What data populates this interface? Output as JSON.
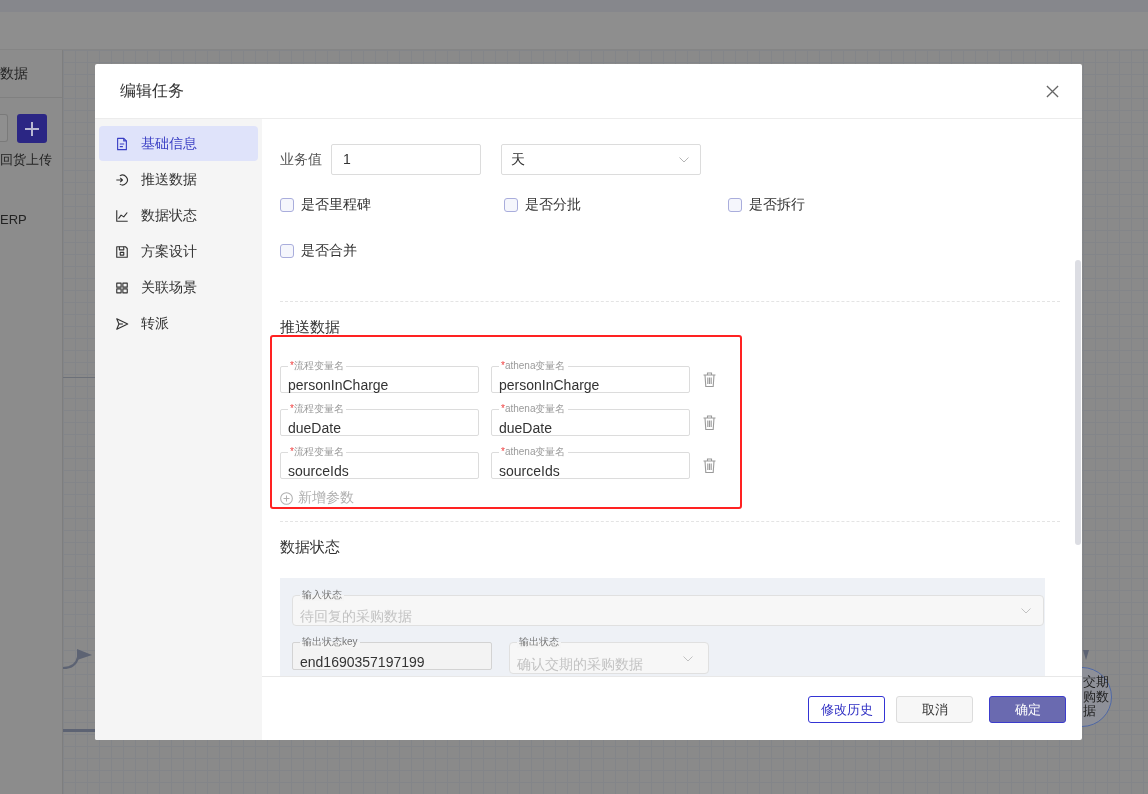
{
  "background": {
    "side_panel": {
      "title": "数据",
      "items": [
        "回货上传",
        "ERP"
      ]
    },
    "canvas": {
      "node": {
        "lines": [
          "交期",
          "购数",
          "据"
        ]
      }
    }
  },
  "dialog": {
    "title": "编辑任务",
    "nav": [
      {
        "label": "基础信息",
        "selected": true
      },
      {
        "label": "推送数据",
        "selected": false
      },
      {
        "label": "数据状态",
        "selected": false
      },
      {
        "label": "方案设计",
        "selected": false
      },
      {
        "label": "关联场景",
        "selected": false
      },
      {
        "label": "转派",
        "selected": false
      }
    ],
    "business_value": {
      "label": "业务值",
      "value": "1",
      "unit": "天"
    },
    "checkboxes": [
      {
        "label": "是否里程碑",
        "checked": false
      },
      {
        "label": "是否分批",
        "checked": false
      },
      {
        "label": "是否拆行",
        "checked": false
      },
      {
        "label": "是否合并",
        "checked": false
      }
    ],
    "push_data": {
      "heading": "推送数据",
      "highlighted": true,
      "params": [
        {
          "flow_var": {
            "required_mark": "*",
            "label": "流程变量名",
            "value": "personInCharge"
          },
          "athena_var": {
            "required_mark": "*",
            "label": "athena变量名",
            "value": "personInCharge"
          }
        },
        {
          "flow_var": {
            "required_mark": "*",
            "label": "流程变量名",
            "value": "dueDate"
          },
          "athena_var": {
            "required_mark": "*",
            "label": "athena变量名",
            "value": "dueDate"
          }
        },
        {
          "flow_var": {
            "required_mark": "*",
            "label": "流程变量名",
            "value": "sourceIds"
          },
          "athena_var": {
            "required_mark": "*",
            "label": "athena变量名",
            "value": "sourceIds"
          }
        }
      ],
      "add_label": "新增参数"
    },
    "data_status": {
      "heading": "数据状态",
      "input_state": {
        "label": "输入状态",
        "value": "待回复的采购数据",
        "disabled": true
      },
      "output_key": {
        "label": "输出状态key",
        "value": "end1690357197199",
        "readonly": true
      },
      "output_state": {
        "label": "输出状态",
        "value": "确认交期的采购数据",
        "disabled": true
      }
    },
    "buttons": [
      {
        "label": "修改历史",
        "kind": "outline"
      },
      {
        "label": "取消",
        "kind": "default"
      },
      {
        "label": "确定",
        "kind": "primary"
      }
    ]
  }
}
